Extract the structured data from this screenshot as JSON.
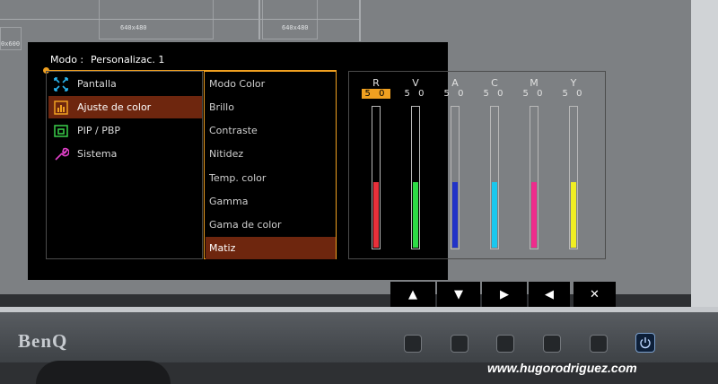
{
  "background": {
    "guide_labels": [
      "640x480",
      "640x480",
      "0x600"
    ]
  },
  "brand": {
    "logo": "BenQ"
  },
  "osd": {
    "mode_label": "Modo :",
    "mode_value": "Personalizac. 1",
    "accent_color": "#f0a020",
    "selected_bg": "#6e260e",
    "main_menu": [
      {
        "label": "Pantalla",
        "icon": "display-arrows-icon",
        "selected": false
      },
      {
        "label": "Ajuste de color",
        "icon": "color-adjust-icon",
        "selected": true
      },
      {
        "label": "PIP / PBP",
        "icon": "pip-icon",
        "selected": false
      },
      {
        "label": "Sistema",
        "icon": "wrench-icon",
        "selected": false
      }
    ],
    "sub_menu": [
      {
        "label": "Modo Color",
        "selected": false
      },
      {
        "label": "Brillo",
        "selected": false
      },
      {
        "label": "Contraste",
        "selected": false
      },
      {
        "label": "Nitidez",
        "selected": false
      },
      {
        "label": "Temp. color",
        "selected": false
      },
      {
        "label": "Gamma",
        "selected": false
      },
      {
        "label": "Gama de color",
        "selected": false
      },
      {
        "label": "Matiz",
        "selected": true
      }
    ],
    "hue_channels": [
      {
        "label": "R",
        "value": "5 0",
        "level": 50,
        "max": 100,
        "color": "#e8303a",
        "selected": true
      },
      {
        "label": "V",
        "value": "5 0",
        "level": 50,
        "max": 100,
        "color": "#2ddc45",
        "selected": false
      },
      {
        "label": "A",
        "value": "5 0",
        "level": 50,
        "max": 100,
        "color": "#2233c8",
        "selected": false
      },
      {
        "label": "C",
        "value": "5 0",
        "level": 50,
        "max": 100,
        "color": "#19c8ee",
        "selected": false
      },
      {
        "label": "M",
        "value": "5 0",
        "level": 50,
        "max": 100,
        "color": "#ee2c8c",
        "selected": false
      },
      {
        "label": "Y",
        "value": "5 0",
        "level": 50,
        "max": 100,
        "color": "#f0ee22",
        "selected": false
      }
    ],
    "button_hints": [
      {
        "glyph": "▲",
        "icon": "up-arrow-icon"
      },
      {
        "glyph": "▼",
        "icon": "down-arrow-icon"
      },
      {
        "glyph": "▶",
        "icon": "right-arrow-icon"
      },
      {
        "glyph": "◀",
        "icon": "left-arrow-icon"
      },
      {
        "glyph": "✕",
        "icon": "close-icon"
      }
    ]
  },
  "hardware_buttons": [
    "osd-key-1",
    "osd-key-2",
    "osd-key-3",
    "osd-key-4",
    "osd-key-5"
  ],
  "power_icon": "power-icon",
  "watermark": "www.hugorodriguez.com"
}
